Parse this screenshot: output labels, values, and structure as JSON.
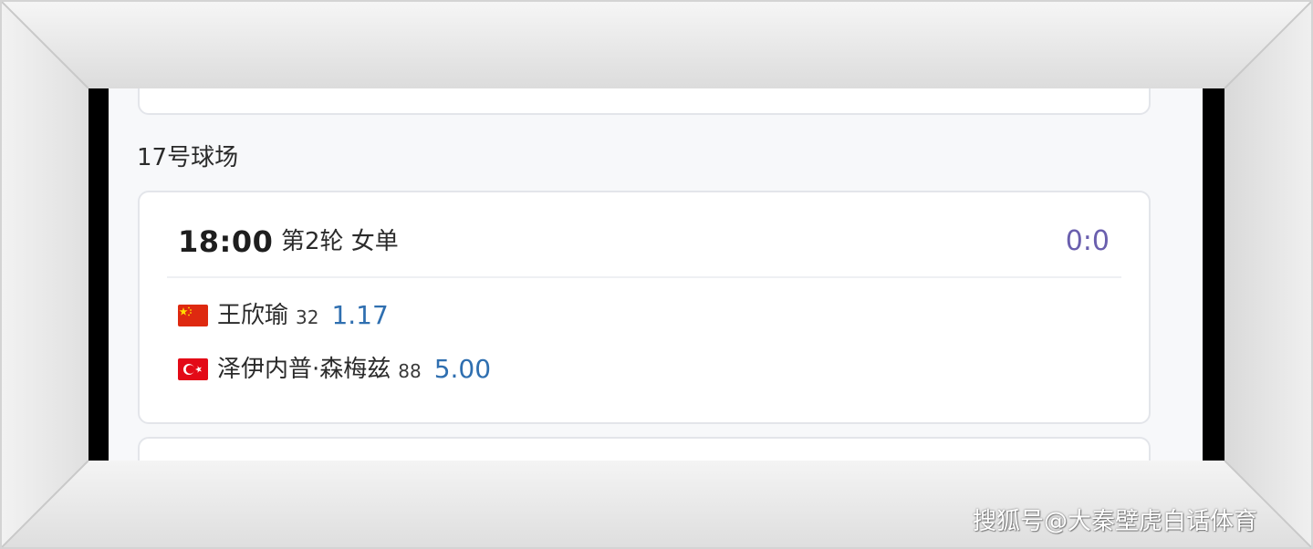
{
  "court": {
    "title": "17号球场"
  },
  "match": {
    "time": "18:00",
    "round": "第2轮 女单",
    "score": "0:0",
    "players": [
      {
        "flag": "china-flag-icon",
        "name": "王欣瑜",
        "rank": "32",
        "odds": "1.17"
      },
      {
        "flag": "turkey-flag-icon",
        "name": "泽伊内普·森梅兹",
        "rank": "88",
        "odds": "5.00"
      }
    ]
  },
  "watermark": {
    "text": "搜狐号@大秦壁虎白话体育"
  },
  "colors": {
    "frame": "#e6e6e6",
    "score": "#6a5fae",
    "odds": "#2f6fb0",
    "card_border": "#e3e5ea",
    "page_background": "#f7f8fa"
  }
}
